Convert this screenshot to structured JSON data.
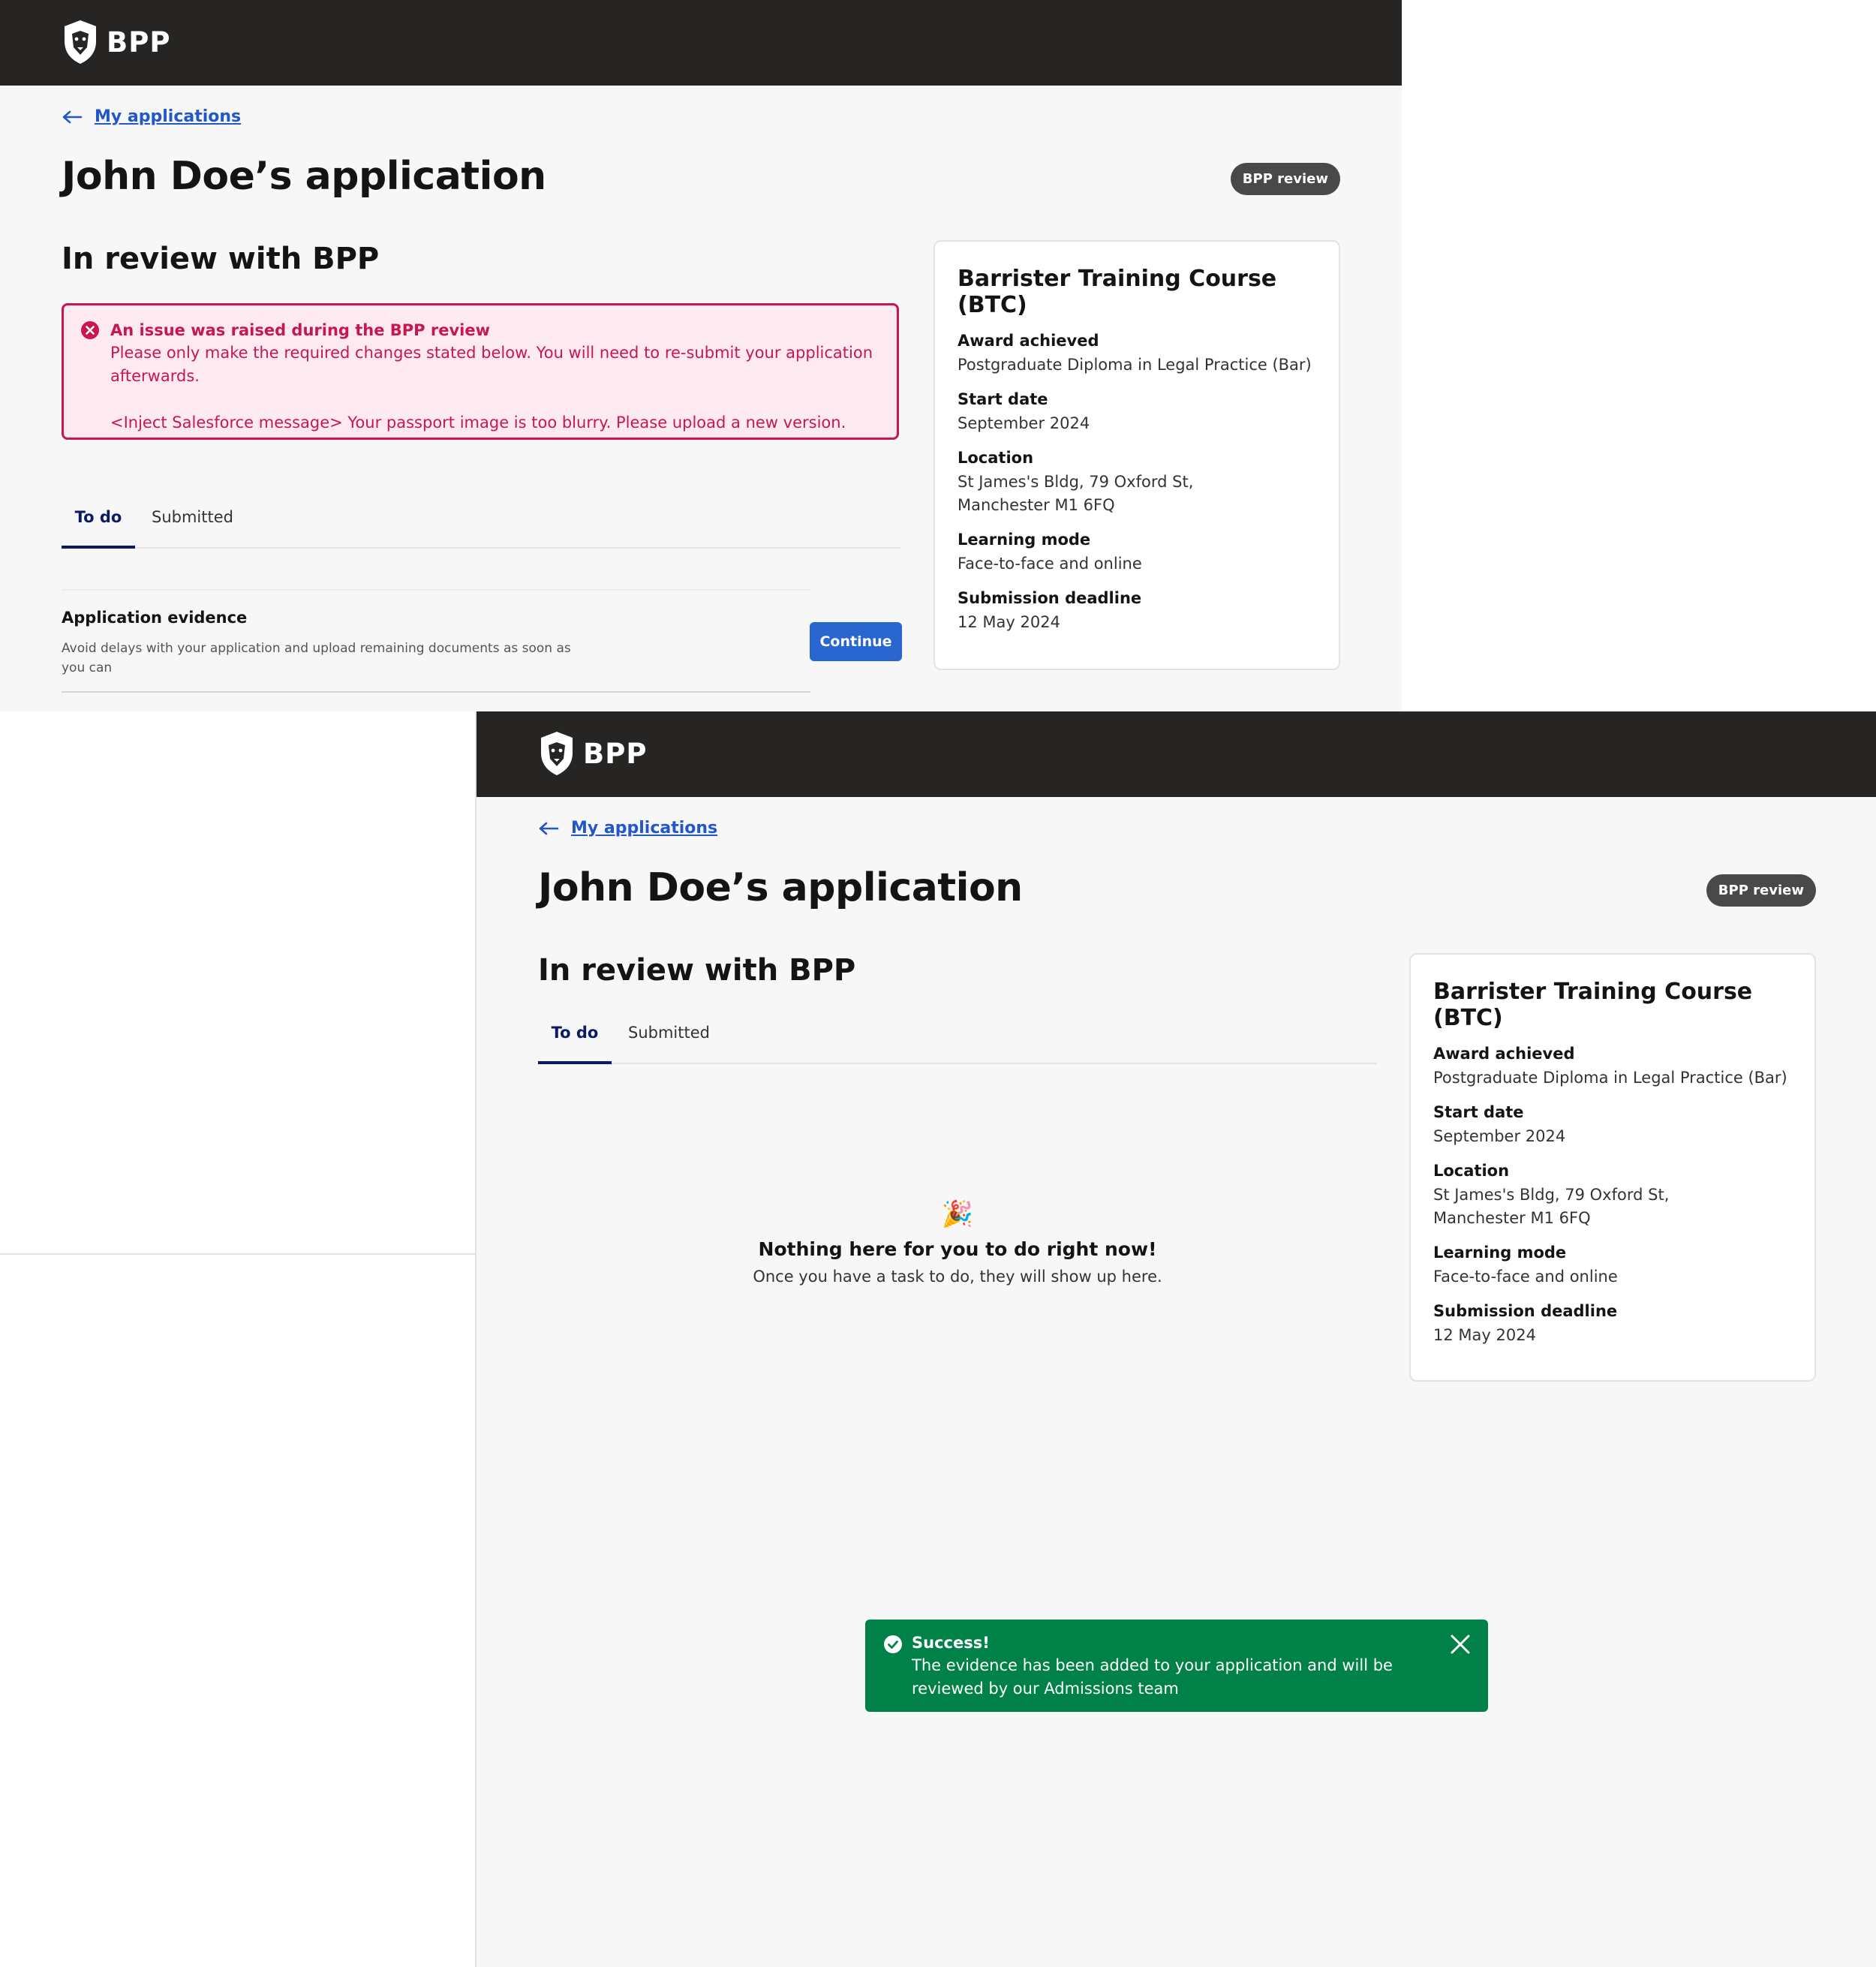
{
  "brand": {
    "name": "BPP",
    "logo_icon": "lion-shield-logo"
  },
  "nav": {
    "back_label": "My applications"
  },
  "application": {
    "title": "John Doe’s application",
    "status_badge": "BPP review",
    "section_title": "In review with BPP"
  },
  "alert": {
    "title": "An issue was raised during the BPP review",
    "body": "Please only make the required changes stated below. You will need to re-submit your application afterwards.",
    "message": "<Inject Salesforce message> Your passport image is too blurry. Please upload a new version."
  },
  "tabs": [
    {
      "label": "To do"
    },
    {
      "label": "Submitted"
    }
  ],
  "task": {
    "title": "Application evidence",
    "description": "Avoid delays with your application and upload remaining documents as soon as you can",
    "button": "Continue"
  },
  "course": {
    "title": "Barrister Training Course (BTC)",
    "fields": [
      {
        "label": "Award achieved",
        "value": "Postgraduate Diploma in Legal Practice (Bar)"
      },
      {
        "label": "Start date",
        "value": "September 2024"
      },
      {
        "label": "Location",
        "value_lines": [
          "St James's Bldg, 79 Oxford St,",
          "Manchester M1 6FQ"
        ]
      },
      {
        "label": "Learning mode",
        "value": "Face-to-face and online"
      },
      {
        "label": "Submission deadline",
        "value": "12 May 2024"
      }
    ]
  },
  "empty_state": {
    "emoji": "🎉",
    "title": "Nothing here for you to do right now!",
    "subtitle": "Once you have a task to do, they will show up here."
  },
  "toast": {
    "title": "Success!",
    "body": "The evidence has been added to your application and will be reviewed by our Admissions team"
  },
  "colors": {
    "header_bg": "#262524",
    "page_bg": "#f8f7f7",
    "link": "#2257c9",
    "error": "#c8174f",
    "error_bg": "#fdeaf0",
    "primary_button": "#2a66d0",
    "tab_active": "#0b1a66",
    "success": "#008148",
    "badge_bg": "#4a4949"
  }
}
